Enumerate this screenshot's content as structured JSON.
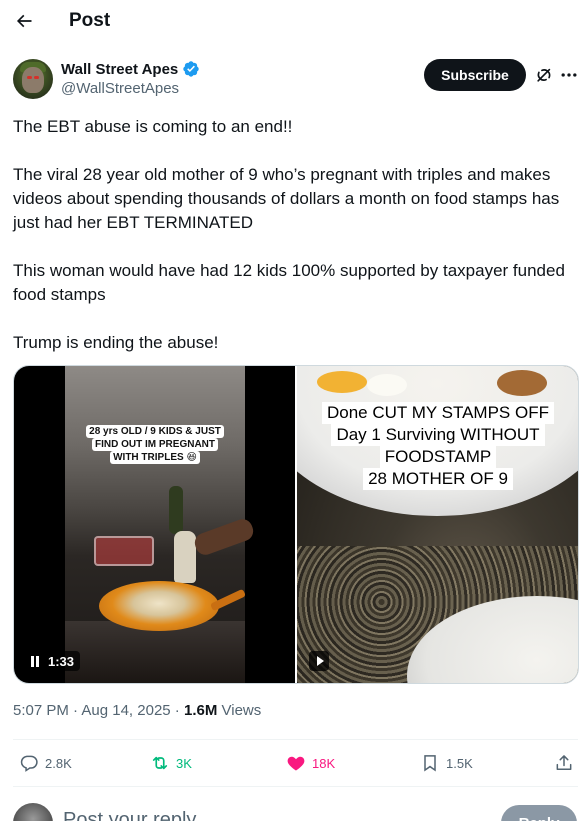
{
  "header": {
    "title": "Post"
  },
  "author": {
    "display_name": "Wall Street Apes",
    "handle": "@WallStreetApes",
    "verified_color": "#1d9bf0",
    "subscribe_label": "Subscribe",
    "icons": [
      "verified-badge-icon",
      "grok-icon",
      "more-icon"
    ]
  },
  "tweet": {
    "paragraphs": [
      "The EBT abuse is coming to an end!!",
      "The viral 28 year old mother of 9 who’s pregnant with triples and makes videos about spending thousands of dollars a month on food stamps has just had her EBT TERMINATED",
      "This woman would have had 12 kids 100% supported by taxpayer funded food stamps",
      "Trump is ending the abuse!"
    ]
  },
  "media": {
    "video_left": {
      "caption_line1": "28 yrs OLD / 9 KIDS &  JUST",
      "caption_line2": "FIND OUT IM PREGNANT",
      "caption_line3": "WITH TRIPLES 😆",
      "duration": "1:33"
    },
    "video_right": {
      "overlay_lines": [
        "Done CUT MY STAMPS OFF",
        "Day 1 Surviving WITHOUT",
        "FOODSTAMP",
        "28 MOTHER OF 9"
      ]
    }
  },
  "meta": {
    "time": "5:07 PM",
    "separator": " · ",
    "date": "Aug 14, 2025",
    "views_count": "1.6M",
    "views_label": " Views"
  },
  "actions": {
    "replies": "2.8K",
    "reposts": "3K",
    "likes": "18K",
    "bookmarks": "1.5K",
    "retweet_color": "#00ba7c",
    "like_color": "#f91880"
  },
  "reply": {
    "placeholder": "Post your reply",
    "button_label": "Reply"
  }
}
